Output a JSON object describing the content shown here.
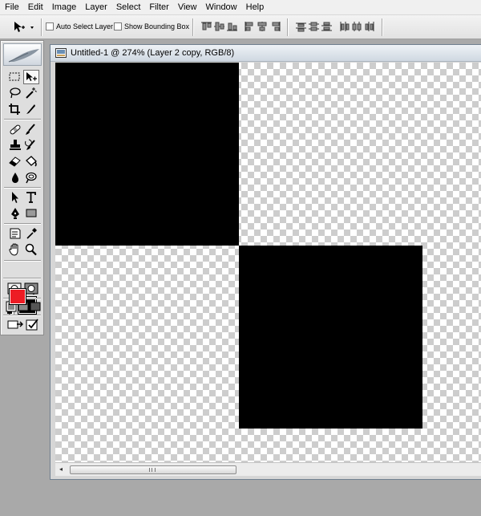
{
  "menu": [
    "File",
    "Edit",
    "Image",
    "Layer",
    "Select",
    "Filter",
    "View",
    "Window",
    "Help"
  ],
  "options": {
    "auto_select_label": "Auto Select Layer",
    "auto_select_checked": false,
    "bounding_box_label": "Show Bounding Box",
    "bounding_box_checked": false
  },
  "document": {
    "title": "Untitled-1 @ 274% (Layer 2 copy, RGB/8)"
  },
  "colors": {
    "foreground": "#ed1c24",
    "background": "#000000",
    "canvas_fill": "#000000"
  },
  "toolbox": {
    "tools": [
      "rectangular-marquee",
      "move",
      "lasso",
      "magic-wand",
      "crop",
      "slice",
      "healing-brush",
      "brush",
      "clone-stamp",
      "history-brush",
      "eraser",
      "paint-bucket",
      "blur",
      "dodge",
      "path-selection",
      "type",
      "pen",
      "rectangle",
      "notes",
      "eyedropper",
      "hand",
      "zoom"
    ],
    "active_tool": "move"
  }
}
